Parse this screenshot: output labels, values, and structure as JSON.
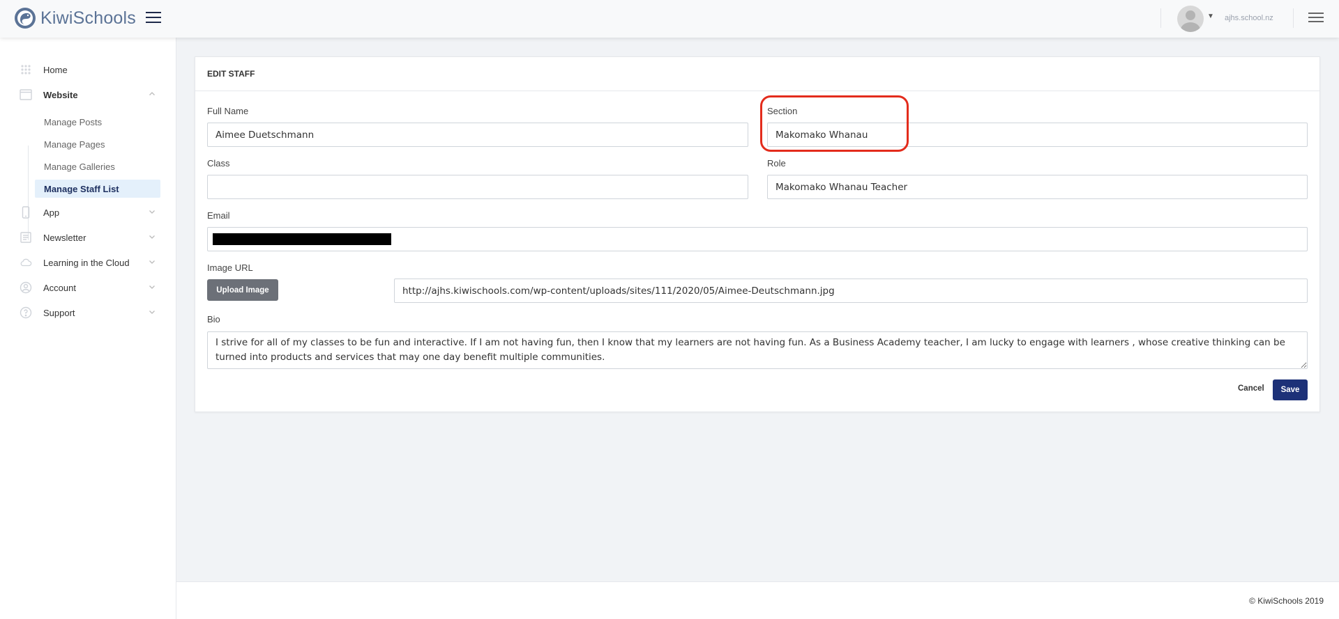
{
  "app": {
    "name": "KiwiSchools",
    "domain": "ajhs.school.nz",
    "accent": "#1d3178",
    "highlight_color": "#e32c1c"
  },
  "sidebar": {
    "items": [
      {
        "label": "Home",
        "icon": "grid-icon"
      },
      {
        "label": "Website",
        "icon": "browser-window-icon",
        "expanded": true
      },
      {
        "label": "App",
        "icon": "mobile-phone-icon"
      },
      {
        "label": "Newsletter",
        "icon": "newspaper-icon"
      },
      {
        "label": "Learning in the Cloud",
        "icon": "cloud-icon"
      },
      {
        "label": "Account",
        "icon": "user-circle-icon"
      },
      {
        "label": "Support",
        "icon": "help-circle-icon"
      }
    ],
    "website_sub": [
      {
        "label": "Manage Posts"
      },
      {
        "label": "Manage Pages"
      },
      {
        "label": "Manage Galleries"
      },
      {
        "label": "Manage Staff List",
        "active": true
      }
    ]
  },
  "form": {
    "title": "EDIT STAFF",
    "full_name": {
      "label": "Full Name",
      "value": "Aimee Duetschmann"
    },
    "section": {
      "label": "Section",
      "value": "Makomako Whanau"
    },
    "class": {
      "label": "Class",
      "value": ""
    },
    "role": {
      "label": "Role",
      "value": "Makomako Whanau Teacher"
    },
    "email": {
      "label": "Email",
      "value": ""
    },
    "image_url": {
      "label": "Image URL",
      "value": "http://ajhs.kiwischools.com/wp-content/uploads/sites/111/2020/05/Aimee-Deutschmann.jpg"
    },
    "upload_label": "Upload Image",
    "bio": {
      "label": "Bio",
      "value": "I strive for all of my classes to be fun and interactive. If I am not having fun, then I know that my learners are not having fun. As a Business Academy teacher, I am lucky to engage with learners , whose creative thinking can be turned into products and services that may one day benefit multiple communities."
    },
    "cancel_label": "Cancel",
    "save_label": "Save"
  },
  "footer": {
    "text": "© KiwiSchools 2019"
  }
}
